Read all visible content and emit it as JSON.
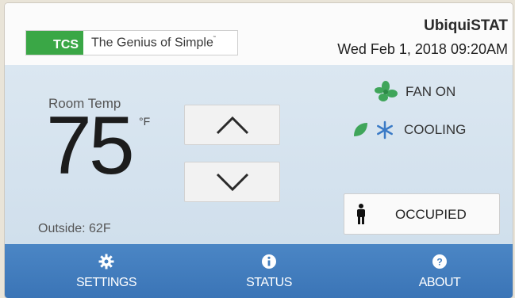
{
  "header": {
    "logo_mark": "TCS",
    "tagline": "The Genius of Simple",
    "brand": "UbiquiSTAT",
    "datetime": "Wed Feb 1, 2018  09:20AM"
  },
  "main": {
    "room_label": "Room Temp",
    "temperature": "75",
    "unit": "°F",
    "outside": "Outside: 62F",
    "fan_status": "FAN ON",
    "mode_status": "COOLING",
    "occupancy_label": "OCCUPIED"
  },
  "footer": {
    "nav": [
      {
        "label": "SETTINGS",
        "icon": "gear-icon"
      },
      {
        "label": "STATUS",
        "icon": "info-icon"
      },
      {
        "label": "ABOUT",
        "icon": "help-icon"
      }
    ]
  },
  "colors": {
    "brand_green": "#3aa746",
    "nav_blue": "#3f7cbd",
    "panel_blue": "#d6e3ef",
    "fan_green": "#3fa55a",
    "snow_blue": "#3a7ac6"
  }
}
